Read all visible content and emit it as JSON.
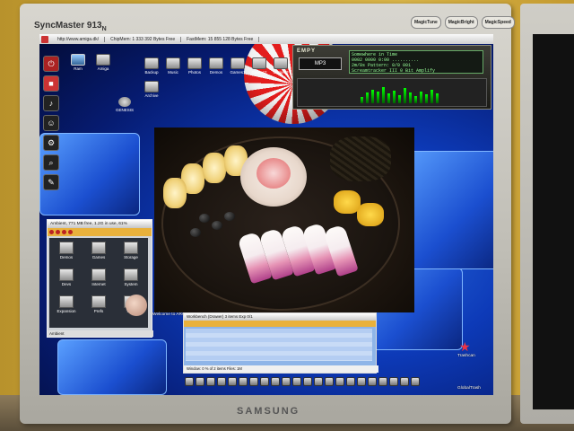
{
  "monitor": {
    "model": "SyncMaster 913",
    "model_suffix": "N",
    "brand": "SAMSUNG",
    "badges": [
      "MagicTune",
      "MagicBright",
      "MagicSpeed"
    ]
  },
  "titlebar": {
    "host": "http://www.amiga.dk/",
    "chip": "ChipMem: 1 333 392 Bytes Free",
    "fast": "FastMem: 15 855 128 Bytes Free"
  },
  "desktop_icons": [
    {
      "label": "Ram"
    },
    {
      "label": "Amiga"
    },
    {
      "label": "Backup"
    },
    {
      "label": "Music"
    },
    {
      "label": "Photos"
    },
    {
      "label": "Demos"
    },
    {
      "label": "Games1"
    },
    {
      "label": "Games2"
    },
    {
      "label": "Games3"
    },
    {
      "label": "Archive"
    },
    {
      "label": "GENESIS"
    }
  ],
  "player": {
    "logo": "EMPY",
    "transport": "MP3",
    "lcd_lines": [
      "Somewhere in Time",
      "0002 0000 0:00 ..........",
      "2m/0s  Pattern: 0/0 001",
      "Screamtracker III  0 Bit Amplify"
    ],
    "eq_levels": [
      0.3,
      0.55,
      0.7,
      0.6,
      0.8,
      0.5,
      0.65,
      0.4,
      0.75,
      0.55,
      0.35,
      0.6,
      0.45,
      0.7,
      0.5
    ]
  },
  "ambient": {
    "title": "Ambient, 771 MB free, 1.2G in use, 61%",
    "drawers": [
      {
        "label": "Demos"
      },
      {
        "label": "Games"
      },
      {
        "label": "Storage"
      },
      {
        "label": "Devs"
      },
      {
        "label": "Internet"
      },
      {
        "label": "System"
      },
      {
        "label": "Expansion"
      },
      {
        "label": "Prefs"
      },
      {
        "label": "Tools"
      }
    ],
    "status": "Ambient"
  },
  "file_manager": {
    "title": "Workbench  (Drawer) 3 items  Exp 0/1",
    "status": "Window: 0 % of 2 items  Files: 1M"
  },
  "desktop_labels": {
    "welcome": "Welcome to AROS",
    "trash": "Trashcan",
    "global": "GlobalTrash"
  }
}
